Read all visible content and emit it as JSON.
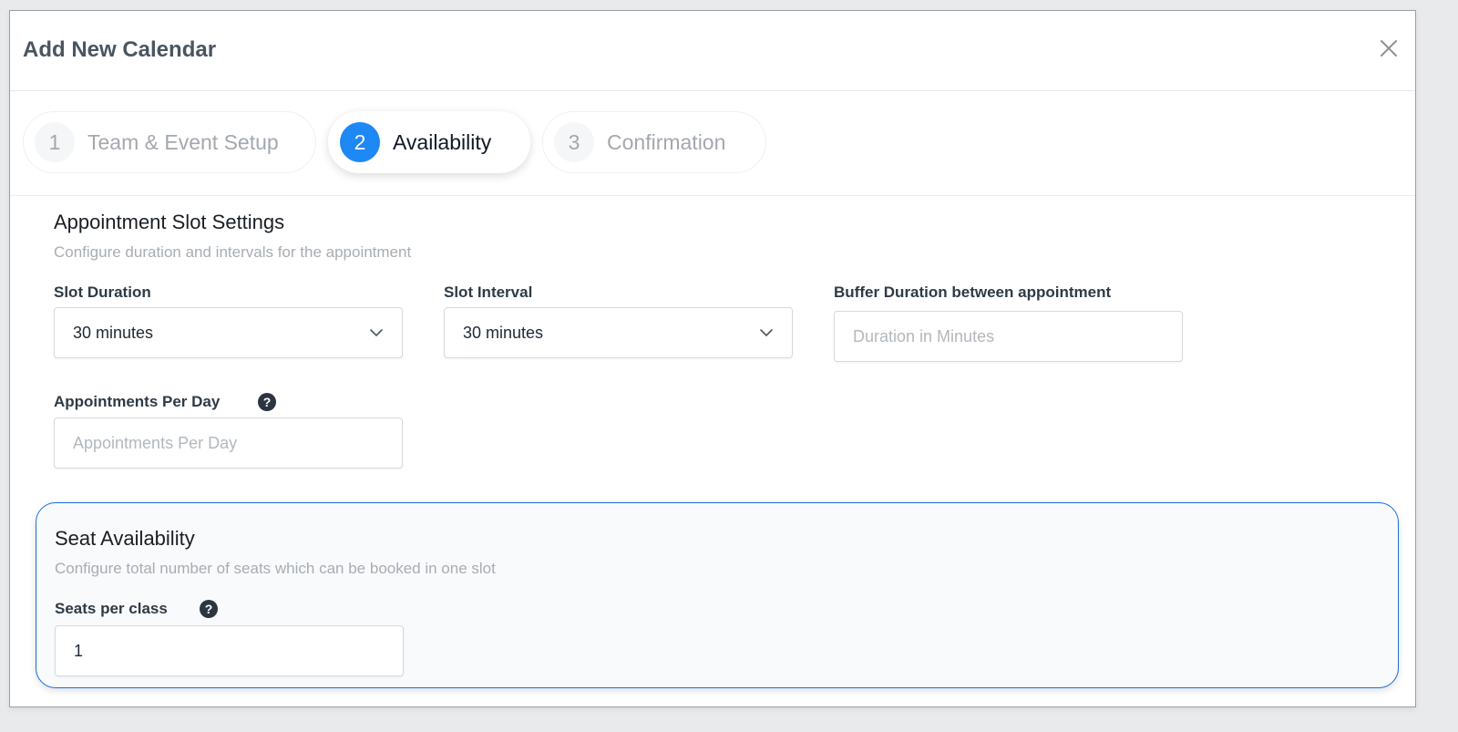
{
  "modal": {
    "title": "Add New Calendar"
  },
  "stepper": {
    "steps": [
      {
        "number": "1",
        "label": "Team & Event Setup",
        "active": false
      },
      {
        "number": "2",
        "label": "Availability",
        "active": true
      },
      {
        "number": "3",
        "label": "Confirmation",
        "active": false
      }
    ]
  },
  "slot_settings": {
    "title": "Appointment Slot Settings",
    "subtitle": "Configure duration and intervals for the appointment",
    "slot_duration": {
      "label": "Slot Duration",
      "value": "30 minutes"
    },
    "slot_interval": {
      "label": "Slot Interval",
      "value": "30 minutes"
    },
    "buffer": {
      "label": "Buffer Duration between appointment",
      "value": "",
      "placeholder": "Duration in Minutes"
    },
    "per_day": {
      "label": "Appointments Per Day",
      "value": "",
      "placeholder": "Appointments Per Day"
    }
  },
  "seat_availability": {
    "title": "Seat Availability",
    "subtitle": "Configure total number of seats which can be booked in one slot",
    "seats": {
      "label": "Seats per class",
      "value": "1"
    }
  },
  "icons": {
    "close": "close-icon",
    "chevron": "chevron-down-icon",
    "help": "question-circle-icon"
  },
  "colors": {
    "accent": "#1e88f4",
    "seat_border": "#1a6fd8"
  }
}
